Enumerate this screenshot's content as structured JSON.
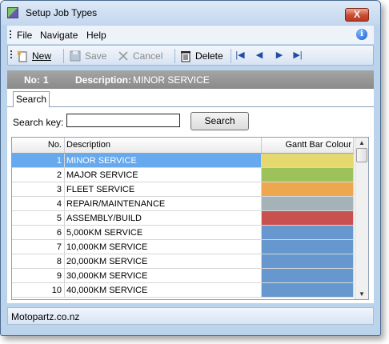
{
  "window": {
    "title": "Setup Job Types",
    "close_glyph": "X"
  },
  "menu": [
    "File",
    "Navigate",
    "Help"
  ],
  "toolbar": {
    "new": "New",
    "save": "Save",
    "cancel": "Cancel",
    "delete": "Delete"
  },
  "header": {
    "no_label": "No:",
    "no_value": "1",
    "desc_label": "Description:",
    "desc_value": "MINOR SERVICE"
  },
  "tabs": [
    "Search"
  ],
  "search": {
    "label": "Search key:",
    "value": "",
    "button": "Search"
  },
  "grid": {
    "columns": [
      "No.",
      "Description",
      "Gantt Bar Colour"
    ],
    "rows": [
      {
        "no": "1",
        "desc": "MINOR SERVICE",
        "color": "#e5d86e",
        "selected": true
      },
      {
        "no": "2",
        "desc": "MAJOR SERVICE",
        "color": "#9ec25a"
      },
      {
        "no": "3",
        "desc": "FLEET SERVICE",
        "color": "#eda84f"
      },
      {
        "no": "4",
        "desc": "REPAIR/MAINTENANCE",
        "color": "#a3b3b8"
      },
      {
        "no": "5",
        "desc": "ASSEMBLY/BUILD",
        "color": "#c8504f"
      },
      {
        "no": "6",
        "desc": "5,000KM SERVICE",
        "color": "#6698cf"
      },
      {
        "no": "7",
        "desc": "10,000KM SERVICE",
        "color": "#6698cf"
      },
      {
        "no": "8",
        "desc": "20,000KM SERVICE",
        "color": "#6698cf"
      },
      {
        "no": "9",
        "desc": "30,000KM SERVICE",
        "color": "#6698cf"
      },
      {
        "no": "10",
        "desc": "40,000KM SERVICE",
        "color": "#6698cf"
      }
    ]
  },
  "status": {
    "text": "Motopartz.co.nz"
  }
}
